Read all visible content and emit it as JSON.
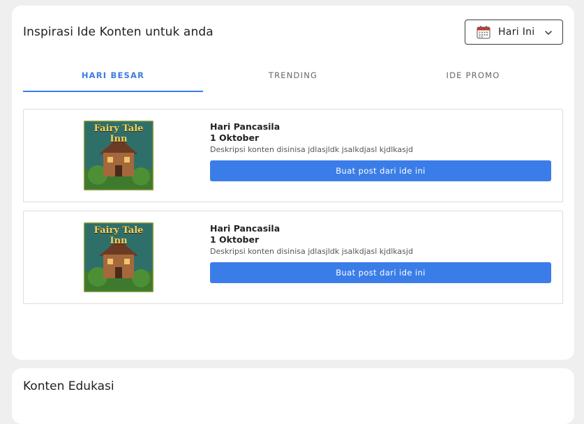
{
  "ideas_card": {
    "title": "Inspirasi Ide Konten untuk anda",
    "date_filter": {
      "label": "Hari Ini",
      "icon": "calendar-icon"
    },
    "tabs": [
      {
        "label": "HARI BESAR",
        "active": true
      },
      {
        "label": "TRENDING",
        "active": false
      },
      {
        "label": "IDE PROMO",
        "active": false
      }
    ],
    "items": [
      {
        "name": "Hari Pancasila",
        "date": "1 Oktober",
        "description": "Deskripsi konten disinisa jdlasjldk jsalkdjasl kjdlkasjd",
        "button_label": "Buat post dari ide ini",
        "image_text": "Fairy Tale Inn"
      },
      {
        "name": "Hari Pancasila",
        "date": "1 Oktober",
        "description": "Deskripsi konten disinisa jdlasjldk jsalkdjasl kjdlkasjd",
        "button_label": "Buat post dari ide ini",
        "image_text": "Fairy Tale Inn"
      }
    ]
  },
  "education_card": {
    "title": "Konten Edukasi"
  },
  "colors": {
    "accent": "#3b7de0",
    "button": "#3b7de8",
    "background": "#efefef",
    "card": "#ffffff"
  }
}
